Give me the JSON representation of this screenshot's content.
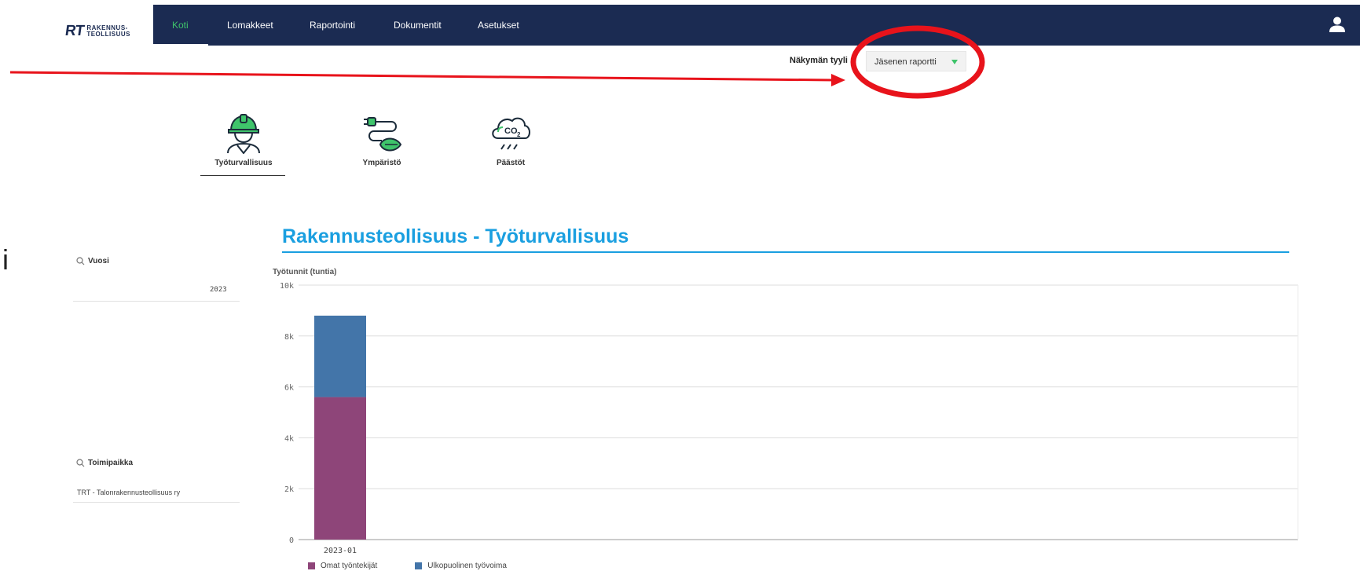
{
  "logo": {
    "mark": "RT",
    "line1": "RAKENNUS-",
    "line2": "TEOLLISUUS"
  },
  "nav": {
    "items": [
      {
        "label": "Koti",
        "active": true
      },
      {
        "label": "Lomakkeet",
        "active": false
      },
      {
        "label": "Raportointi",
        "active": false
      },
      {
        "label": "Dokumentit",
        "active": false
      },
      {
        "label": "Asetukset",
        "active": false
      }
    ]
  },
  "view_style": {
    "label": "Näkymän tyyli",
    "value": "Jäsenen raportti"
  },
  "categories": [
    {
      "label": "Työturvallisuus",
      "icon": "worker-hardhat-icon",
      "selected": true
    },
    {
      "label": "Ympäristö",
      "icon": "plug-leaf-icon",
      "selected": false
    },
    {
      "label": "Päästöt",
      "icon": "co2-cloud-icon",
      "selected": false
    }
  ],
  "stray_text": "i",
  "filters": {
    "year": {
      "title": "Vuosi",
      "value": "2023"
    },
    "location": {
      "title": "Toimipaikka",
      "value": "TRT - Talonrakennusteollisuus ry"
    }
  },
  "chart_data": {
    "type": "bar",
    "stacked": true,
    "title": "Rakennusteollisuus - Työturvallisuus",
    "ylabel": "Työtunnit (tuntia)",
    "xlabel": "",
    "categories": [
      "2023-01"
    ],
    "series": [
      {
        "name": "Omat työntekijät",
        "values": [
          5600
        ],
        "color": "#8e4579"
      },
      {
        "name": "Ulkopuolinen työvoima",
        "values": [
          3200
        ],
        "color": "#4375a9"
      }
    ],
    "ylim": [
      0,
      10000
    ],
    "yticks": [
      {
        "value": 0,
        "label": "0"
      },
      {
        "value": 2000,
        "label": "2k"
      },
      {
        "value": 4000,
        "label": "4k"
      },
      {
        "value": 6000,
        "label": "6k"
      },
      {
        "value": 8000,
        "label": "8k"
      },
      {
        "value": 10000,
        "label": "10k"
      }
    ],
    "grid": true,
    "legend": "bottom-left"
  },
  "colors": {
    "navbar": "#1b2b52",
    "accent_green": "#3fc46b",
    "title_blue": "#1a9fe0",
    "annotation_red": "#e8131b"
  }
}
